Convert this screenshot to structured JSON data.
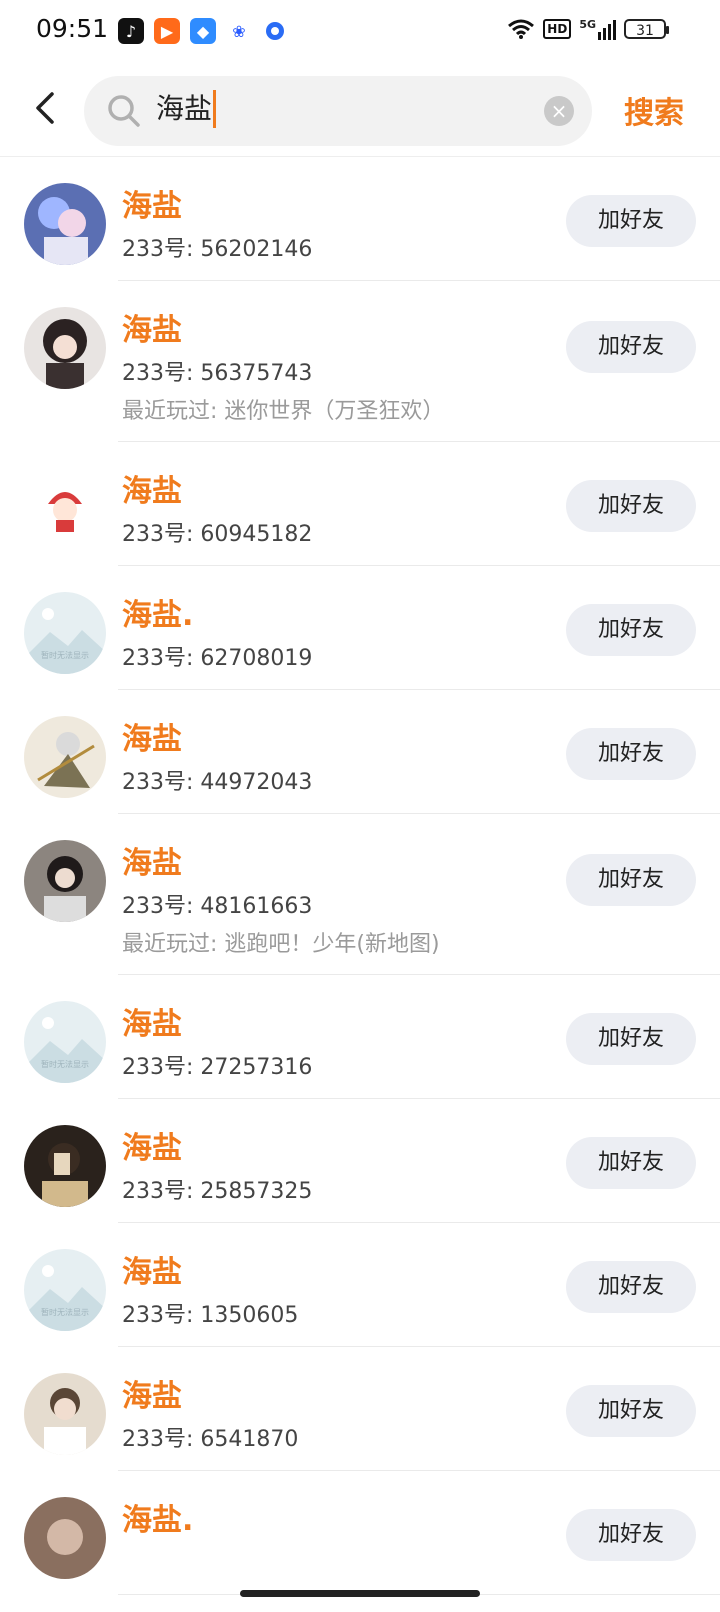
{
  "status": {
    "time": "09:51",
    "network": "5G",
    "hd": "HD",
    "battery": "31"
  },
  "search": {
    "query": "海盐",
    "button": "搜索"
  },
  "results": [
    {
      "name": "海盐",
      "uid": "233号: 56202146",
      "recent": "",
      "add": "加好友",
      "avatar": "anime-girl-blue"
    },
    {
      "name": "海盐",
      "uid": "233号: 56375743",
      "recent": "最近玩过: 迷你世界（万圣狂欢）",
      "add": "加好友",
      "avatar": "anime-girl-dark-hair"
    },
    {
      "name": "海盐",
      "uid": "233号: 60945182",
      "recent": "",
      "add": "加好友",
      "avatar": "cartoon-red-hood"
    },
    {
      "name": "海盐.",
      "uid": "233号: 62708019",
      "recent": "",
      "add": "加好友",
      "avatar": "placeholder"
    },
    {
      "name": "海盐",
      "uid": "233号: 44972043",
      "recent": "",
      "add": "加好友",
      "avatar": "anime-warrior"
    },
    {
      "name": "海盐",
      "uid": "233号: 48161663",
      "recent": "最近玩过: 逃跑吧！少年(新地图)",
      "add": "加好友",
      "avatar": "photo-girl"
    },
    {
      "name": "海盐",
      "uid": "233号: 27257316",
      "recent": "",
      "add": "加好友",
      "avatar": "placeholder"
    },
    {
      "name": "海盐",
      "uid": "233号: 25857325",
      "recent": "",
      "add": "加好友",
      "avatar": "photo-selfie"
    },
    {
      "name": "海盐",
      "uid": "233号: 1350605",
      "recent": "",
      "add": "加好友",
      "avatar": "placeholder"
    },
    {
      "name": "海盐",
      "uid": "233号: 6541870",
      "recent": "",
      "add": "加好友",
      "avatar": "photo-boy"
    },
    {
      "name": "海盐.",
      "uid": "",
      "recent": "",
      "add": "加好友",
      "avatar": "photo-partial"
    }
  ],
  "placeholder_text": "暂时无法显示",
  "colors": {
    "accent": "#f07b1d",
    "button_bg": "#eceef3"
  }
}
